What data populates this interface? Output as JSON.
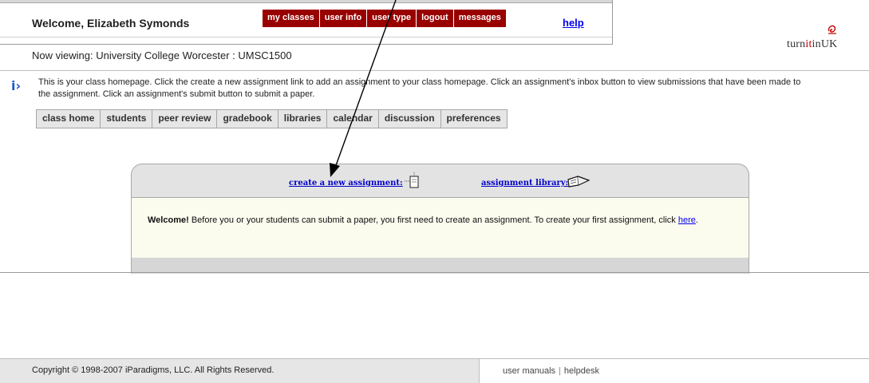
{
  "header": {
    "welcome": "Welcome, Elizabeth Symonds",
    "nav": [
      "my classes",
      "user info",
      "user type",
      "logout",
      "messages"
    ],
    "help": "help",
    "logo_prefix": "turn",
    "logo_accent": "it",
    "logo_suffix": "in",
    "logo_region": "UK"
  },
  "now_viewing": "Now viewing: University College Worcester : UMSC1500",
  "info_text": "This is your class homepage. Click the create a new assignment link to add an assignment to your class homepage. Click an assignment's inbox button to view submissions that have been made to the assignment. Click an assignment's submit button to submit a paper.",
  "tabs": [
    "class home",
    "students",
    "peer review",
    "gradebook",
    "libraries",
    "calendar",
    "discussion",
    "preferences"
  ],
  "box": {
    "create_link": "create a new assignment:",
    "library_link": "assignment library:",
    "welcome_bold": "Welcome!",
    "welcome_text": " Before you or your students can submit a paper, you first need to create an assignment. To create your first assignment, click ",
    "here": "here",
    "period": "."
  },
  "footer": {
    "copyright": "Copyright © 1998-2007 iParadigms, LLC. All Rights Reserved.",
    "user_manuals": "user manuals",
    "separator": "|",
    "helpdesk": "helpdesk"
  },
  "colors": {
    "nav_bg": "#990000",
    "link": "#0000ee",
    "welcome_box": "#fbfbee",
    "info_icon": "#1a5bbf"
  }
}
